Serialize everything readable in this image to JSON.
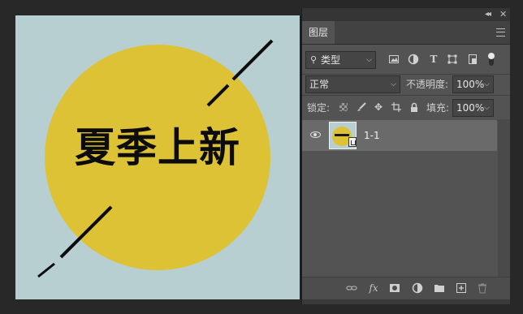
{
  "canvas": {
    "headline": "夏季上新",
    "colors": {
      "background": "#b7cfd1",
      "circle": "#dcc234",
      "stroke": "#0c0c0c"
    }
  },
  "panel": {
    "tab": "图层",
    "filter": {
      "search_glyph": "⚲",
      "value": "类型"
    },
    "filter_icons": [
      "image-filter-icon",
      "adjustment-filter-icon",
      "type-filter-icon",
      "shape-filter-icon",
      "smart-object-filter-icon",
      "filter-toggle-switch"
    ],
    "blend_mode": "正常",
    "opacity_label": "不透明度:",
    "opacity_value": "100%",
    "lock_label": "锁定:",
    "fill_label": "填充:",
    "fill_value": "100%",
    "layers": [
      {
        "name": "1-1",
        "visible": true,
        "selected": true
      }
    ],
    "footer_icons": [
      "link-layers-icon",
      "fx-icon",
      "add-mask-icon",
      "adjustment-layer-icon",
      "group-folder-icon",
      "new-layer-icon",
      "trash-icon"
    ]
  }
}
